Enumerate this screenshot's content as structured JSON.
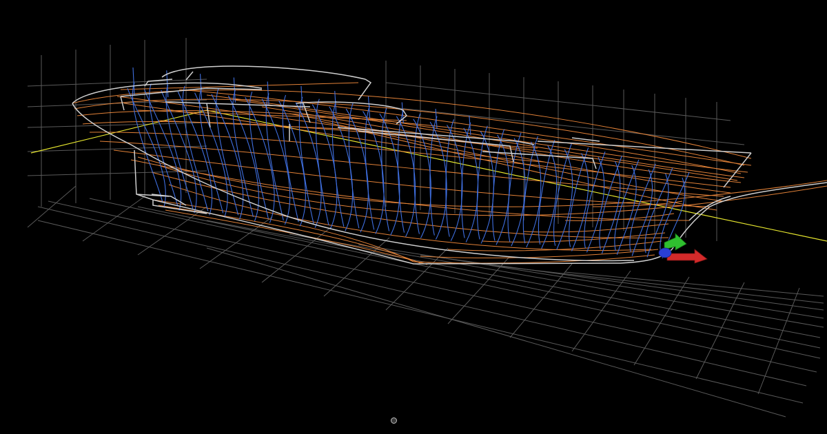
{
  "viewport": {
    "background": "#000000"
  },
  "colors": {
    "grid": "#5a5a5a",
    "station_sections": "#3f6fe0",
    "longitudinal_curves": "#f08a3c",
    "profile_outline": "#cfcfcf",
    "centerline_axis": "#e6e62e",
    "gizmo_x": "#d42a2a",
    "gizmo_y": "#2fbf2f",
    "gizmo_z": "#2a3fd4"
  },
  "icons": {
    "transform_gizmo": "xyz-axes-gizmo-icon",
    "orbit_control": "orbit-dot-icon"
  }
}
